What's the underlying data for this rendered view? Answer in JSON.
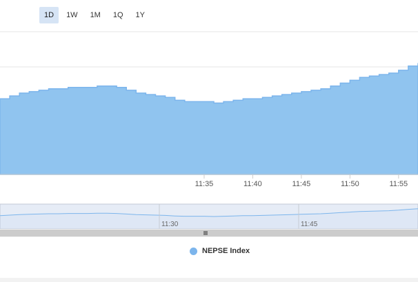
{
  "range_selector": {
    "buttons": [
      "1D",
      "1W",
      "1M",
      "1Q",
      "1Y"
    ],
    "active": "1D"
  },
  "colors": {
    "area_fill": "#90c4ef",
    "area_line": "#7cb5ec",
    "button_active_bg": "#d6e4f5",
    "navigator_mask": "#d2dcee"
  },
  "navigator": {
    "tick_labels": [
      "11:30",
      "11:45"
    ],
    "scroll_handle_icon": "grip-lines-icon"
  },
  "legend": {
    "entries": [
      {
        "name": "NEPSE Index",
        "color": "#7cb5ec"
      }
    ]
  },
  "chart_data": {
    "type": "area",
    "title": "",
    "xlabel": "",
    "ylabel": "",
    "x_ticks": [
      "11:35",
      "11:40",
      "11:45",
      "11:50",
      "11:55"
    ],
    "x_range": [
      "11:14",
      "11:57"
    ],
    "y_range": [
      0,
      100
    ],
    "grid": true,
    "legend_position": "bottom-center",
    "series": [
      {
        "name": "NEPSE Index",
        "x": [
          "11:14",
          "11:15",
          "11:16",
          "11:17",
          "11:18",
          "11:19",
          "11:20",
          "11:21",
          "11:22",
          "11:23",
          "11:24",
          "11:25",
          "11:26",
          "11:27",
          "11:28",
          "11:29",
          "11:30",
          "11:31",
          "11:32",
          "11:33",
          "11:34",
          "11:35",
          "11:36",
          "11:37",
          "11:38",
          "11:39",
          "11:40",
          "11:41",
          "11:42",
          "11:43",
          "11:44",
          "11:45",
          "11:46",
          "11:47",
          "11:48",
          "11:49",
          "11:50",
          "11:51",
          "11:52",
          "11:53",
          "11:54",
          "11:55",
          "11:56",
          "11:57"
        ],
        "values": [
          53,
          55,
          57,
          58,
          59,
          60,
          60,
          61,
          61,
          61,
          62,
          62,
          61,
          59,
          57,
          56,
          55,
          54,
          52,
          51,
          51,
          51,
          50,
          51,
          52,
          53,
          53,
          54,
          55,
          56,
          57,
          58,
          59,
          60,
          62,
          64,
          66,
          68,
          69,
          70,
          71,
          73,
          76,
          78
        ]
      }
    ]
  }
}
